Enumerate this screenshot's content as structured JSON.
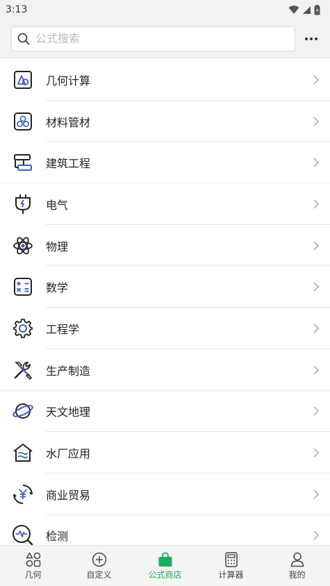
{
  "status": {
    "time": "3:13"
  },
  "search": {
    "placeholder": "公式搜索"
  },
  "categories": [
    {
      "label": "几何计算",
      "icon": "geometry-icon"
    },
    {
      "label": "材料管材",
      "icon": "materials-icon"
    },
    {
      "label": "建筑工程",
      "icon": "construction-icon"
    },
    {
      "label": "电气",
      "icon": "electric-plug-icon"
    },
    {
      "label": "物理",
      "icon": "atom-icon"
    },
    {
      "label": "数学",
      "icon": "math-icon"
    },
    {
      "label": "工程学",
      "icon": "gear-icon"
    },
    {
      "label": "生产制造",
      "icon": "tools-icon"
    },
    {
      "label": "天文地理",
      "icon": "planet-icon"
    },
    {
      "label": "水厂应用",
      "icon": "water-plant-icon"
    },
    {
      "label": "商业贸易",
      "icon": "yuan-exchange-icon"
    },
    {
      "label": "检测",
      "icon": "detection-icon"
    }
  ],
  "tabs": [
    {
      "label": "几何",
      "icon": "geometry-tab-icon"
    },
    {
      "label": "自定义",
      "icon": "plus-circle-icon"
    },
    {
      "label": "公式商店",
      "icon": "shopping-bag-icon",
      "active": true
    },
    {
      "label": "计算器",
      "icon": "calculator-icon"
    },
    {
      "label": "我的",
      "icon": "user-icon"
    }
  ],
  "colors": {
    "accent": "#1aad5b",
    "icon_blue": "#3d5fc4",
    "icon_dark": "#222222"
  }
}
